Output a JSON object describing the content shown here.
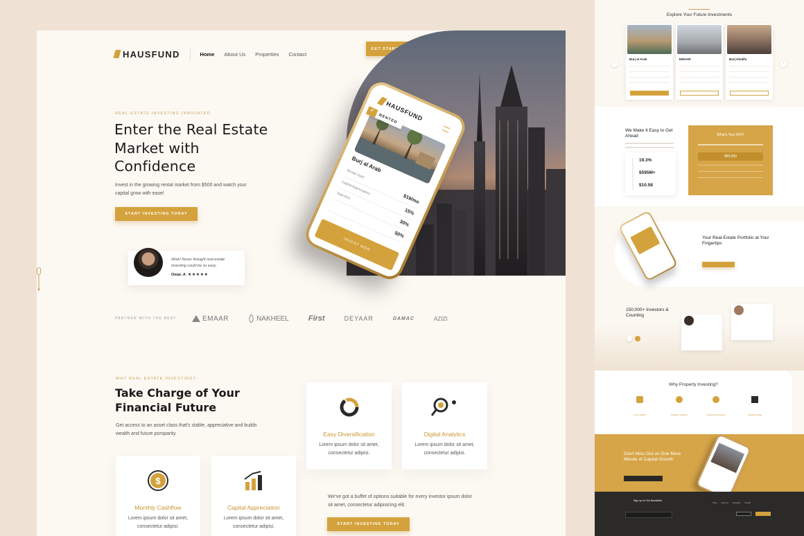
{
  "colors": {
    "gold": "#d4a23c",
    "dark": "#2b2a29",
    "background": "#fcf8f2"
  },
  "brand": {
    "name": "HAUSFUND"
  },
  "nav": {
    "items": [
      "Home",
      "About Us",
      "Properties",
      "Contact"
    ],
    "active": "Home",
    "cta": "GET STARTED",
    "user_icon": "user-icon"
  },
  "hero": {
    "eyebrow": "REAL-ESTATE INVESTING INNOVATED",
    "title": "Enter the Real Estate Market with Confidence",
    "subtitle": "Invest in the growing rental market from $500 and watch your capital grow with ease!",
    "cta": "START INVESTING TODAY"
  },
  "testimonial": {
    "quote": "Wow! Never thought real-estate investing could be so easy.",
    "author": "Omar. A",
    "stars": "★★★★★",
    "rating": 5
  },
  "phone": {
    "logo": "HAUSFUND",
    "badge": "RENTED",
    "property": "Burj al Arab",
    "rows": [
      {
        "label": "Rental Yield",
        "value": "$19/mo"
      },
      {
        "label": "Capital Appreciation",
        "value": "15%"
      },
      {
        "label": "Total ROI",
        "value": "30%"
      },
      {
        "label": "",
        "value": "50%"
      }
    ],
    "cta": "INVEST NOW"
  },
  "partners": {
    "label": "PARTNER WITH THE BEST",
    "logos": [
      "EMAAR",
      "NAKHEEL",
      "First",
      "DEYAAR",
      "DAMAC",
      "AZIZI"
    ]
  },
  "why": {
    "eyebrow": "WHY REAL ESTATE INVESTING?",
    "title": "Take Charge of Your Financial Future",
    "subtitle": "Get access to an asset class that's stable, appreciative and builds wealth and future porsparity.",
    "features": [
      {
        "title": "Easy Diversification",
        "desc": "Lorem ipsum dolor sit amet, consectetur adipisi.",
        "icon": "donut-chart-icon"
      },
      {
        "title": "Digital Analytics",
        "desc": "Lorem ipsum dolor sit amet, consectetur adipisi.",
        "icon": "analytics-search-icon"
      },
      {
        "title": "Monthly Cashflow",
        "desc": "Lorem ipsum dolor sit amet, consectetur adipisi.",
        "icon": "dollar-coin-icon"
      },
      {
        "title": "Capital Appreciation",
        "desc": "Lorem ipsum dolor sit amet, consectetur adipisi.",
        "icon": "growth-bars-icon"
      }
    ],
    "buffet": "We've got a buffet of options suitable for every investor ipsum dolor sit amet, consectetur adipisicing elit.",
    "cta": "START INVESTING TODAY"
  },
  "right_panel": {
    "explore_title": "Explore Your Future Investments",
    "properties": [
      {
        "name": "Burj al Arab"
      },
      {
        "name": "EMAAR"
      },
      {
        "name": "Burj Khalifa"
      }
    ],
    "ease_title": "We Make It Easy to Get Ahead",
    "stats": [
      "19.3%",
      "$595M+",
      "$10.58"
    ],
    "roi_title": "What's Your ROI?",
    "roi_value": "$90,000",
    "portfolio_title": "Your Real-Estate Portfolio at Your Fingertips",
    "investors_title": "150,000+ Investors & Counting",
    "why_title": "Why Property Investing?",
    "why_items": [
      "Low volatility",
      "Regular Cashflow",
      "Capital Appreciation",
      "Inflation Hedge"
    ],
    "miss_title": "Don't Miss Out on One More Minute of Capital Growth",
    "newsletter_title": "Sign up for Our Newsletter"
  }
}
